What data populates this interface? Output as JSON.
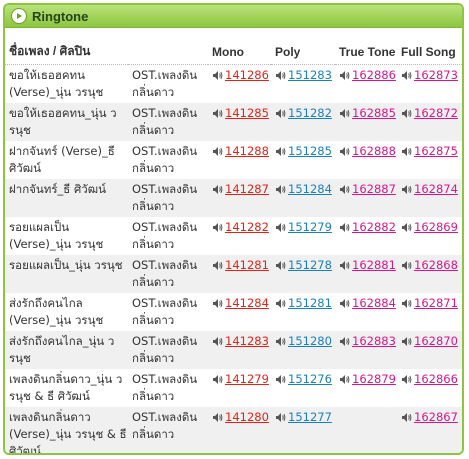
{
  "header": {
    "title": "Ringtone"
  },
  "columns": {
    "song": "ชื่อเพลง / ศิลปิน",
    "mono": "Mono",
    "poly": "Poly",
    "truetone": "True Tone",
    "fullsong": "Full Song"
  },
  "rows": [
    {
      "song": "ขอให้เธอฮคทน (Verse)_นุ่น วรนุช",
      "album": "OST.เพลงดินกลิ่นดาว",
      "mono": "141286",
      "poly": "151283",
      "truetone": "162886",
      "fullsong": "162873"
    },
    {
      "song": "ขอให้เธอฮคทน_นุ่น วรนุช",
      "album": "OST.เพลงดินกลิ่นดาว",
      "mono": "141285",
      "poly": "151282",
      "truetone": "162885",
      "fullsong": "162872"
    },
    {
      "song": "ฝากจันทร์ (Verse)_ธี ศิวัฒน์",
      "album": "OST.เพลงดินกลิ่นดาว",
      "mono": "141288",
      "poly": "151285",
      "truetone": "162888",
      "fullsong": "162875"
    },
    {
      "song": "ฝากจันทร์_ธี ศิวัฒน์",
      "album": "OST.เพลงดินกลิ่นดาว",
      "mono": "141287",
      "poly": "151284",
      "truetone": "162887",
      "fullsong": "162874"
    },
    {
      "song": "รอยแผลเป็น (Verse)_นุ่น วรนุช",
      "album": "OST.เพลงดินกลิ่นดาว",
      "mono": "141282",
      "poly": "151279",
      "truetone": "162882",
      "fullsong": "162869"
    },
    {
      "song": "รอยแผลเป็น_นุ่น วรนุช",
      "album": "OST.เพลงดินกลิ่นดาว",
      "mono": "141281",
      "poly": "151278",
      "truetone": "162881",
      "fullsong": "162868"
    },
    {
      "song": "ส่งรักถึงคนไกล (Verse)_นุ่น วรนุช",
      "album": "OST.เพลงดินกลิ่นดาว",
      "mono": "141284",
      "poly": "151281",
      "truetone": "162884",
      "fullsong": "162871"
    },
    {
      "song": "ส่งรักถึงคนไกล_นุ่น วรนุช",
      "album": "OST.เพลงดินกลิ่นดาว",
      "mono": "141283",
      "poly": "151280",
      "truetone": "162883",
      "fullsong": "162870"
    },
    {
      "song": "เพลงดินกลิ่นดาว_นุ่น วรนุช & ธี ศิวัฒน์",
      "album": "OST.เพลงดินกลิ่นดาว",
      "mono": "141279",
      "poly": "151276",
      "truetone": "162879",
      "fullsong": "162866"
    },
    {
      "song": "เพลงดินกลิ่นดาว (Verse)_นุ่น วรนุช & ธี ศิวัฒน์",
      "album": "OST.เพลงดินกลิ่นดาว",
      "mono": "141280",
      "poly": "151277",
      "truetone": "",
      "fullsong": "162867"
    }
  ]
}
